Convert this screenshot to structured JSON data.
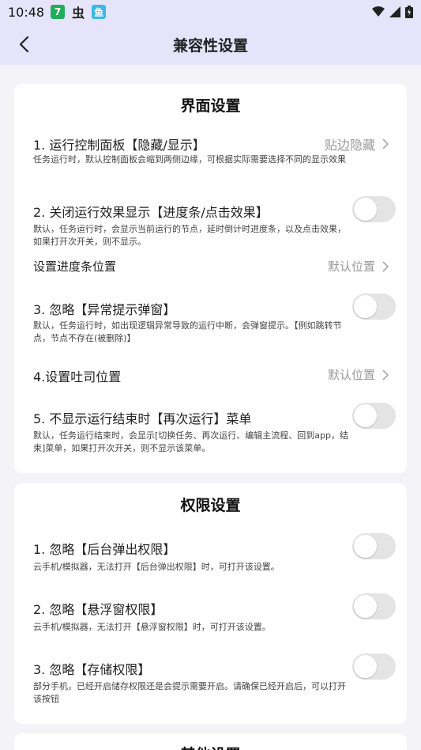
{
  "status": {
    "time": "10:48",
    "app_icons": [
      "7",
      "虫",
      "鱼"
    ]
  },
  "header": {
    "title": "兼容性设置"
  },
  "interface": {
    "title": "界面设置",
    "items": [
      {
        "title": "1. 运行控制面板【隐藏/显示】",
        "desc": "任务运行时，默认控制面板会缩到两侧边缘，可根据实际需要选择不同的显示效果",
        "value": "贴边隐藏"
      },
      {
        "title": "2. 关闭运行效果显示【进度条/点击效果】",
        "desc": "默认，任务运行时，会显示当前运行的节点，延时倒计时进度条，以及点击效果，如果打开次开关，则不显示。",
        "toggle": false
      },
      {
        "title": "设置进度条位置",
        "value": "默认位置"
      },
      {
        "title": "3. 忽略【异常提示弹窗】",
        "desc": "默认，任务运行时，如出现逻辑异常导致的运行中断，会弹窗提示。【例如跳转节点，节点不存在(被删除)】",
        "toggle": false
      },
      {
        "title": "4.设置吐司位置",
        "value": "默认位置"
      },
      {
        "title": "5. 不显示运行结束时【再次运行】菜单",
        "desc": "默认，任务运行结束时，会显示[切换任务、再次运行、编辑主流程、回到app，结束]菜单，如果打开次开关，则不显示该菜单。",
        "toggle": false
      }
    ]
  },
  "permission": {
    "title": "权限设置",
    "items": [
      {
        "title": "1. 忽略【后台弹出权限】",
        "desc": "云手机/模拟器，无法打开【后台弹出权限】时，可打开该设置。",
        "toggle": false
      },
      {
        "title": "2. 忽略【悬浮窗权限】",
        "desc": "云手机/模拟器，无法打开【悬浮窗权限】时，可打开该设置。",
        "toggle": false
      },
      {
        "title": "3. 忽略【存储权限】",
        "desc": "部分手机，已经开启储存权限还是会提示需要开启。请确保已经开启后，可以打开该按钮",
        "toggle": false
      }
    ]
  },
  "other": {
    "title": "其他设置"
  }
}
